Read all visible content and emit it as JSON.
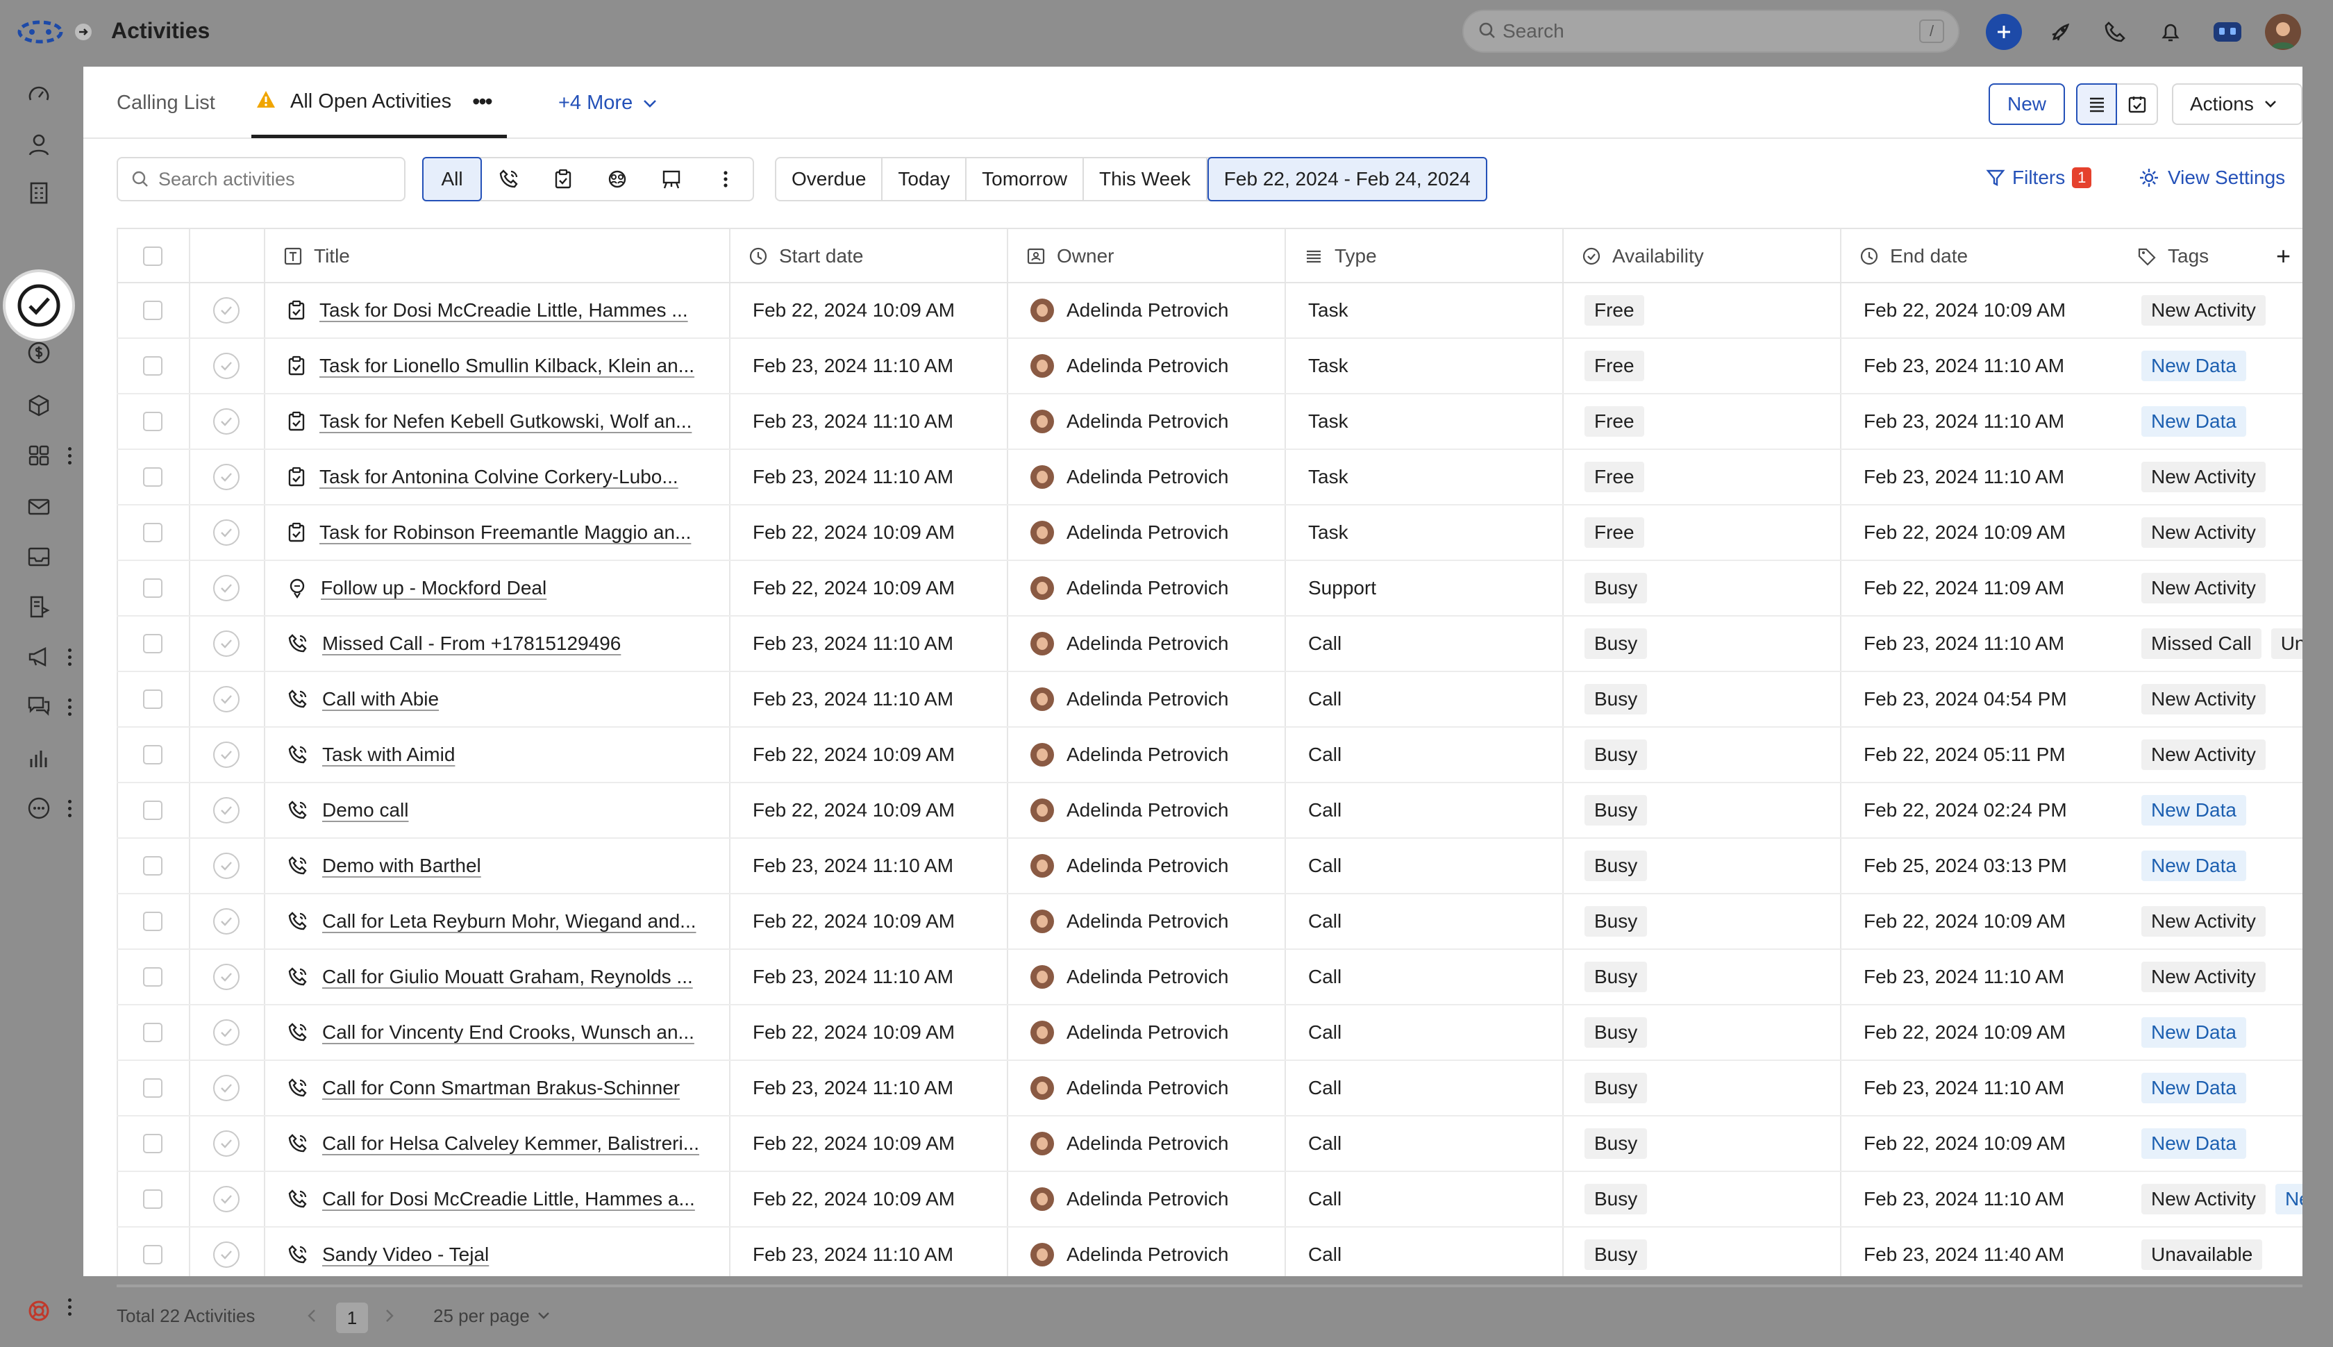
{
  "app": {
    "title": "Activities",
    "search_placeholder": "Search",
    "search_shortcut": "/"
  },
  "tabs": {
    "calling_list": "Calling List",
    "all_open": "All Open Activities",
    "more": "+4 More",
    "new_label": "New",
    "actions_label": "Actions"
  },
  "toolbar": {
    "search_placeholder": "Search activities",
    "type_all": "All",
    "dates": [
      "Overdue",
      "Today",
      "Tomorrow",
      "This Week",
      "Feb 22, 2024 - Feb 24, 2024"
    ],
    "filters_label": "Filters",
    "filters_count": "1",
    "view_settings_label": "View Settings"
  },
  "table": {
    "columns": {
      "title": "Title",
      "start": "Start date",
      "owner": "Owner",
      "type": "Type",
      "availability": "Availability",
      "end": "End date",
      "tags": "Tags"
    },
    "rows": [
      {
        "icon": "task",
        "title": "Task for Dosi McCreadie Little, Hammes ...",
        "start": "Feb 22, 2024 10:09 AM",
        "owner": "Adelinda Petrovich",
        "type": "Task",
        "availability": "Free",
        "end": "Feb 22, 2024 10:09 AM",
        "tags": [
          {
            "text": "New Activity",
            "blue": false
          }
        ]
      },
      {
        "icon": "task",
        "title": "Task for Lionello Smullin Kilback, Klein an...",
        "start": "Feb 23, 2024 11:10 AM",
        "owner": "Adelinda Petrovich",
        "type": "Task",
        "availability": "Free",
        "end": "Feb 23, 2024 11:10 AM",
        "tags": [
          {
            "text": "New Data",
            "blue": true
          }
        ]
      },
      {
        "icon": "task",
        "title": "Task for Nefen Kebell Gutkowski, Wolf an...",
        "start": "Feb 23, 2024 11:10 AM",
        "owner": "Adelinda Petrovich",
        "type": "Task",
        "availability": "Free",
        "end": "Feb 23, 2024 11:10 AM",
        "tags": [
          {
            "text": "New Data",
            "blue": true
          }
        ]
      },
      {
        "icon": "task",
        "title": "Task for Antonina Colvine Corkery-Lubo...",
        "start": "Feb 23, 2024 11:10 AM",
        "owner": "Adelinda Petrovich",
        "type": "Task",
        "availability": "Free",
        "end": "Feb 23, 2024 11:10 AM",
        "tags": [
          {
            "text": "New Activity",
            "blue": false
          }
        ]
      },
      {
        "icon": "task",
        "title": "Task for Robinson Freemantle Maggio an...",
        "start": "Feb 22, 2024 10:09 AM",
        "owner": "Adelinda Petrovich",
        "type": "Task",
        "availability": "Free",
        "end": "Feb 22, 2024 10:09 AM",
        "tags": [
          {
            "text": "New Activity",
            "blue": false
          }
        ]
      },
      {
        "icon": "support",
        "title": "Follow up - Mockford Deal",
        "start": "Feb 22, 2024 10:09 AM",
        "owner": "Adelinda Petrovich",
        "type": "Support",
        "availability": "Busy",
        "end": "Feb 22, 2024 11:09 AM",
        "tags": [
          {
            "text": "New Activity",
            "blue": false
          }
        ]
      },
      {
        "icon": "call",
        "title": "Missed Call - From +17815129496",
        "start": "Feb 23, 2024 11:10 AM",
        "owner": "Adelinda Petrovich",
        "type": "Call",
        "availability": "Busy",
        "end": "Feb 23, 2024 11:10 AM",
        "tags": [
          {
            "text": "Missed Call",
            "blue": false
          },
          {
            "text": "Unavailable",
            "blue": false
          }
        ]
      },
      {
        "icon": "call",
        "title": "Call with Abie",
        "start": "Feb 23, 2024 11:10 AM",
        "owner": "Adelinda Petrovich",
        "type": "Call",
        "availability": "Busy",
        "end": "Feb 23, 2024 04:54 PM",
        "tags": [
          {
            "text": "New Activity",
            "blue": false
          }
        ]
      },
      {
        "icon": "call",
        "title": "Task with Aimid",
        "start": "Feb 22, 2024 10:09 AM",
        "owner": "Adelinda Petrovich",
        "type": "Call",
        "availability": "Busy",
        "end": "Feb 22, 2024 05:11 PM",
        "tags": [
          {
            "text": "New Activity",
            "blue": false
          }
        ]
      },
      {
        "icon": "call",
        "title": "Demo call",
        "start": "Feb 22, 2024 10:09 AM",
        "owner": "Adelinda Petrovich",
        "type": "Call",
        "availability": "Busy",
        "end": "Feb 22, 2024 02:24 PM",
        "tags": [
          {
            "text": "New Data",
            "blue": true
          }
        ]
      },
      {
        "icon": "call",
        "title": "Demo with Barthel",
        "start": "Feb 23, 2024 11:10 AM",
        "owner": "Adelinda Petrovich",
        "type": "Call",
        "availability": "Busy",
        "end": "Feb 25, 2024 03:13 PM",
        "tags": [
          {
            "text": "New Data",
            "blue": true
          }
        ]
      },
      {
        "icon": "call",
        "title": "Call for Leta Reyburn Mohr, Wiegand and...",
        "start": "Feb 22, 2024 10:09 AM",
        "owner": "Adelinda Petrovich",
        "type": "Call",
        "availability": "Busy",
        "end": "Feb 22, 2024 10:09 AM",
        "tags": [
          {
            "text": "New Activity",
            "blue": false
          }
        ]
      },
      {
        "icon": "call",
        "title": "Call for Giulio Mouatt Graham, Reynolds ...",
        "start": "Feb 23, 2024 11:10 AM",
        "owner": "Adelinda Petrovich",
        "type": "Call",
        "availability": "Busy",
        "end": "Feb 23, 2024 11:10 AM",
        "tags": [
          {
            "text": "New Activity",
            "blue": false
          }
        ]
      },
      {
        "icon": "call",
        "title": "Call for Vincenty End Crooks, Wunsch an...",
        "start": "Feb 22, 2024 10:09 AM",
        "owner": "Adelinda Petrovich",
        "type": "Call",
        "availability": "Busy",
        "end": "Feb 22, 2024 10:09 AM",
        "tags": [
          {
            "text": "New Data",
            "blue": true
          }
        ]
      },
      {
        "icon": "call",
        "title": "Call for Conn Smartman Brakus-Schinner",
        "start": "Feb 23, 2024 11:10 AM",
        "owner": "Adelinda Petrovich",
        "type": "Call",
        "availability": "Busy",
        "end": "Feb 23, 2024 11:10 AM",
        "tags": [
          {
            "text": "New Data",
            "blue": true
          }
        ]
      },
      {
        "icon": "call",
        "title": "Call for Helsa Calveley Kemmer, Balistreri...",
        "start": "Feb 22, 2024 10:09 AM",
        "owner": "Adelinda Petrovich",
        "type": "Call",
        "availability": "Busy",
        "end": "Feb 22, 2024 10:09 AM",
        "tags": [
          {
            "text": "New Data",
            "blue": true
          }
        ]
      },
      {
        "icon": "call",
        "title": "Call for Dosi McCreadie Little, Hammes a...",
        "start": "Feb 22, 2024 10:09 AM",
        "owner": "Adelinda Petrovich",
        "type": "Call",
        "availability": "Busy",
        "end": "Feb 23, 2024 11:10 AM",
        "tags": [
          {
            "text": "New Activity",
            "blue": false
          },
          {
            "text": "New Data",
            "blue": true
          }
        ]
      },
      {
        "icon": "call",
        "title": "Sandy Video - Tejal",
        "start": "Feb 23, 2024 11:10 AM",
        "owner": "Adelinda Petrovich",
        "type": "Call",
        "availability": "Busy",
        "end": "Feb 23, 2024 11:40 AM",
        "tags": [
          {
            "text": "Unavailable",
            "blue": false
          }
        ]
      }
    ]
  },
  "footer": {
    "total": "Total 22 Activities",
    "page": "1",
    "per_page": "25 per page"
  }
}
